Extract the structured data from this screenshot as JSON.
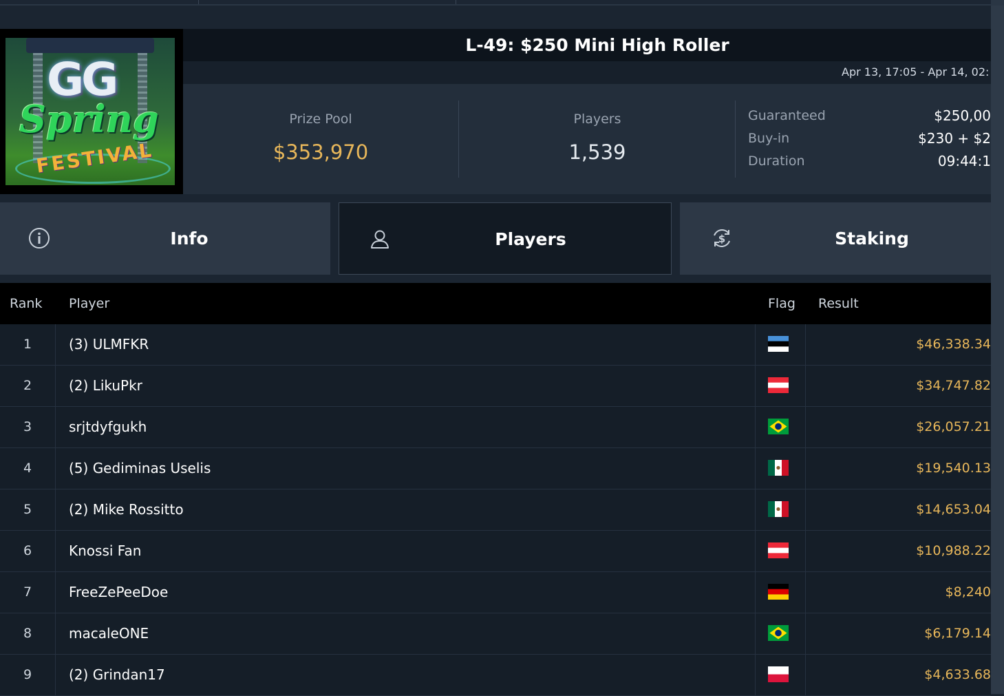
{
  "header": {
    "title": "L-49: $250 Mini High Roller",
    "date_range": "Apr 13, 17:05 - Apr 14, 02:"
  },
  "logo": {
    "line1": "GG",
    "line2": "Spring",
    "line3": "FESTIVAL"
  },
  "stats": {
    "prize_pool_label": "Prize Pool",
    "prize_pool_value": "$353,970",
    "players_label": "Players",
    "players_value": "1,539",
    "details": [
      {
        "label": "Guaranteed",
        "value": "$250,00"
      },
      {
        "label": "Buy-in",
        "value": "$230 + $2"
      },
      {
        "label": "Duration",
        "value": "09:44:1"
      }
    ]
  },
  "tabs": [
    {
      "label": "Info",
      "icon": "info-icon"
    },
    {
      "label": "Players",
      "icon": "user-icon",
      "active": true
    },
    {
      "label": "Staking",
      "icon": "dollar-exchange-icon"
    }
  ],
  "table": {
    "columns": {
      "rank": "Rank",
      "player": "Player",
      "flag": "Flag",
      "result": "Result"
    },
    "rows": [
      {
        "rank": "1",
        "player": "(3) ULMFKR",
        "flag": "estonia",
        "result": "$46,338.34"
      },
      {
        "rank": "2",
        "player": "(2) LikuPkr",
        "flag": "austria",
        "result": "$34,747.82"
      },
      {
        "rank": "3",
        "player": "srjtdyfgukh",
        "flag": "brazil",
        "result": "$26,057.21"
      },
      {
        "rank": "4",
        "player": "(5) Gediminas Uselis",
        "flag": "mexico",
        "result": "$19,540.13"
      },
      {
        "rank": "5",
        "player": "(2) Mike Rossitto",
        "flag": "mexico",
        "result": "$14,653.04"
      },
      {
        "rank": "6",
        "player": "Knossi Fan",
        "flag": "austria",
        "result": "$10,988.22"
      },
      {
        "rank": "7",
        "player": "FreeZePeeDoe",
        "flag": "germany",
        "result": "$8,240"
      },
      {
        "rank": "8",
        "player": "macaleONE",
        "flag": "brazil",
        "result": "$6,179.14"
      },
      {
        "rank": "9",
        "player": "(2) Grindan17",
        "flag": "poland",
        "result": "$4,633.68"
      }
    ]
  },
  "colors": {
    "accent_gold": "#e8b75a",
    "background": "#1b2531",
    "active_tab": "#121a23"
  }
}
